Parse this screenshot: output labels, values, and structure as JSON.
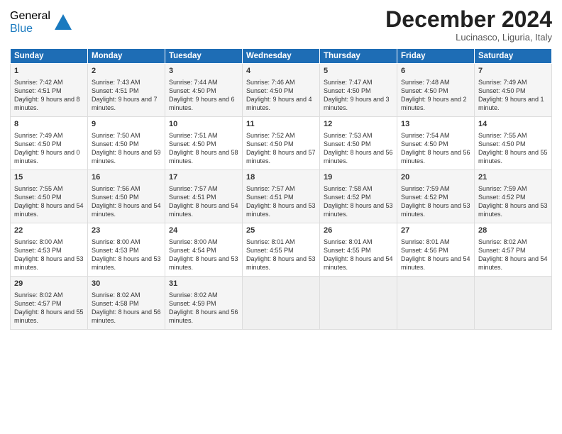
{
  "header": {
    "title": "December 2024",
    "location": "Lucinasco, Liguria, Italy"
  },
  "columns": [
    "Sunday",
    "Monday",
    "Tuesday",
    "Wednesday",
    "Thursday",
    "Friday",
    "Saturday"
  ],
  "weeks": [
    [
      {
        "day": "1",
        "sunrise": "7:42 AM",
        "sunset": "4:51 PM",
        "daylight": "9 hours and 8 minutes."
      },
      {
        "day": "2",
        "sunrise": "7:43 AM",
        "sunset": "4:51 PM",
        "daylight": "9 hours and 7 minutes."
      },
      {
        "day": "3",
        "sunrise": "7:44 AM",
        "sunset": "4:50 PM",
        "daylight": "9 hours and 6 minutes."
      },
      {
        "day": "4",
        "sunrise": "7:46 AM",
        "sunset": "4:50 PM",
        "daylight": "9 hours and 4 minutes."
      },
      {
        "day": "5",
        "sunrise": "7:47 AM",
        "sunset": "4:50 PM",
        "daylight": "9 hours and 3 minutes."
      },
      {
        "day": "6",
        "sunrise": "7:48 AM",
        "sunset": "4:50 PM",
        "daylight": "9 hours and 2 minutes."
      },
      {
        "day": "7",
        "sunrise": "7:49 AM",
        "sunset": "4:50 PM",
        "daylight": "9 hours and 1 minute."
      }
    ],
    [
      {
        "day": "8",
        "sunrise": "7:49 AM",
        "sunset": "4:50 PM",
        "daylight": "9 hours and 0 minutes."
      },
      {
        "day": "9",
        "sunrise": "7:50 AM",
        "sunset": "4:50 PM",
        "daylight": "8 hours and 59 minutes."
      },
      {
        "day": "10",
        "sunrise": "7:51 AM",
        "sunset": "4:50 PM",
        "daylight": "8 hours and 58 minutes."
      },
      {
        "day": "11",
        "sunrise": "7:52 AM",
        "sunset": "4:50 PM",
        "daylight": "8 hours and 57 minutes."
      },
      {
        "day": "12",
        "sunrise": "7:53 AM",
        "sunset": "4:50 PM",
        "daylight": "8 hours and 56 minutes."
      },
      {
        "day": "13",
        "sunrise": "7:54 AM",
        "sunset": "4:50 PM",
        "daylight": "8 hours and 56 minutes."
      },
      {
        "day": "14",
        "sunrise": "7:55 AM",
        "sunset": "4:50 PM",
        "daylight": "8 hours and 55 minutes."
      }
    ],
    [
      {
        "day": "15",
        "sunrise": "7:55 AM",
        "sunset": "4:50 PM",
        "daylight": "8 hours and 54 minutes."
      },
      {
        "day": "16",
        "sunrise": "7:56 AM",
        "sunset": "4:50 PM",
        "daylight": "8 hours and 54 minutes."
      },
      {
        "day": "17",
        "sunrise": "7:57 AM",
        "sunset": "4:51 PM",
        "daylight": "8 hours and 54 minutes."
      },
      {
        "day": "18",
        "sunrise": "7:57 AM",
        "sunset": "4:51 PM",
        "daylight": "8 hours and 53 minutes."
      },
      {
        "day": "19",
        "sunrise": "7:58 AM",
        "sunset": "4:52 PM",
        "daylight": "8 hours and 53 minutes."
      },
      {
        "day": "20",
        "sunrise": "7:59 AM",
        "sunset": "4:52 PM",
        "daylight": "8 hours and 53 minutes."
      },
      {
        "day": "21",
        "sunrise": "7:59 AM",
        "sunset": "4:52 PM",
        "daylight": "8 hours and 53 minutes."
      }
    ],
    [
      {
        "day": "22",
        "sunrise": "8:00 AM",
        "sunset": "4:53 PM",
        "daylight": "8 hours and 53 minutes."
      },
      {
        "day": "23",
        "sunrise": "8:00 AM",
        "sunset": "4:53 PM",
        "daylight": "8 hours and 53 minutes."
      },
      {
        "day": "24",
        "sunrise": "8:00 AM",
        "sunset": "4:54 PM",
        "daylight": "8 hours and 53 minutes."
      },
      {
        "day": "25",
        "sunrise": "8:01 AM",
        "sunset": "4:55 PM",
        "daylight": "8 hours and 53 minutes."
      },
      {
        "day": "26",
        "sunrise": "8:01 AM",
        "sunset": "4:55 PM",
        "daylight": "8 hours and 54 minutes."
      },
      {
        "day": "27",
        "sunrise": "8:01 AM",
        "sunset": "4:56 PM",
        "daylight": "8 hours and 54 minutes."
      },
      {
        "day": "28",
        "sunrise": "8:02 AM",
        "sunset": "4:57 PM",
        "daylight": "8 hours and 54 minutes."
      }
    ],
    [
      {
        "day": "29",
        "sunrise": "8:02 AM",
        "sunset": "4:57 PM",
        "daylight": "8 hours and 55 minutes."
      },
      {
        "day": "30",
        "sunrise": "8:02 AM",
        "sunset": "4:58 PM",
        "daylight": "8 hours and 56 minutes."
      },
      {
        "day": "31",
        "sunrise": "8:02 AM",
        "sunset": "4:59 PM",
        "daylight": "8 hours and 56 minutes."
      },
      null,
      null,
      null,
      null
    ]
  ]
}
